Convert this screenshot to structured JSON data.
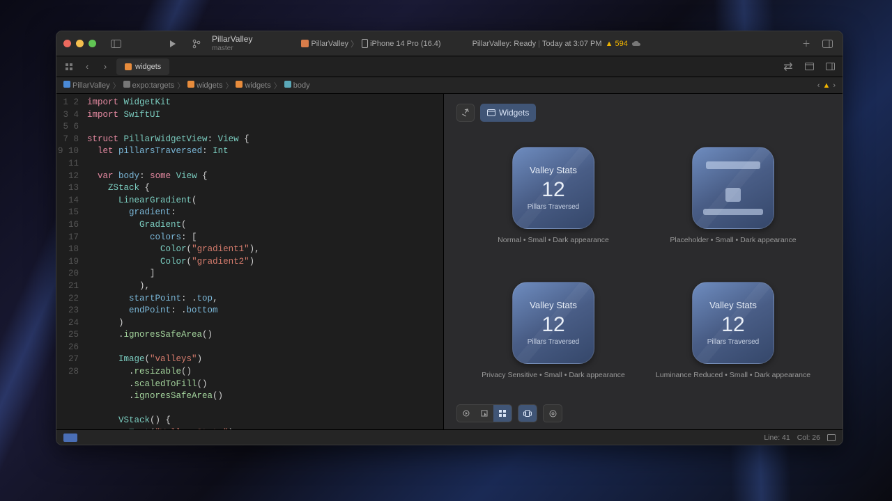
{
  "project": {
    "name": "PillarValley",
    "branch": "master"
  },
  "scheme": {
    "name": "PillarValley",
    "device": "iPhone 14 Pro (16.4)"
  },
  "status": {
    "text": "PillarValley: Ready",
    "timestamp": "Today at 3:07 PM",
    "warnings": "594"
  },
  "tab": {
    "name": "widgets"
  },
  "breadcrumbs": [
    "PillarValley",
    "expo:targets",
    "widgets",
    "widgets",
    "body"
  ],
  "code_lines": [
    "import WidgetKit",
    "import SwiftUI",
    "",
    "struct PillarWidgetView: View {",
    "  let pillarsTraversed: Int",
    "",
    "  var body: some View {",
    "    ZStack {",
    "      LinearGradient(",
    "        gradient:",
    "          Gradient(",
    "            colors: [",
    "              Color(\"gradient1\"),",
    "              Color(\"gradient2\")",
    "            ]",
    "          ),",
    "        startPoint: .top,",
    "        endPoint: .bottom",
    "      )",
    "      .ignoresSafeArea()",
    "",
    "      Image(\"valleys\")",
    "        .resizable()",
    "        .scaledToFill()",
    "        .ignoresSafeArea()",
    "",
    "      VStack() {",
    "        Text(\"Valley Stats\")"
  ],
  "canvas": {
    "mode_label": "Widgets",
    "previews": [
      {
        "title": "Valley Stats",
        "value": "12",
        "subtitle": "Pillars Traversed",
        "caption": "Normal • Small • Dark appearance",
        "kind": "normal"
      },
      {
        "caption": "Placeholder • Small • Dark appearance",
        "kind": "placeholder"
      },
      {
        "title": "Valley Stats",
        "value": "12",
        "subtitle": "Pillars Traversed",
        "caption": "Privacy Sensitive • Small • Dark appearance",
        "kind": "normal"
      },
      {
        "title": "Valley Stats",
        "value": "12",
        "subtitle": "Pillars Traversed",
        "caption": "Luminance Reduced • Small • Dark appearance",
        "kind": "normal"
      }
    ]
  },
  "status_bar": {
    "line": "Line: 41",
    "col": "Col: 26"
  }
}
